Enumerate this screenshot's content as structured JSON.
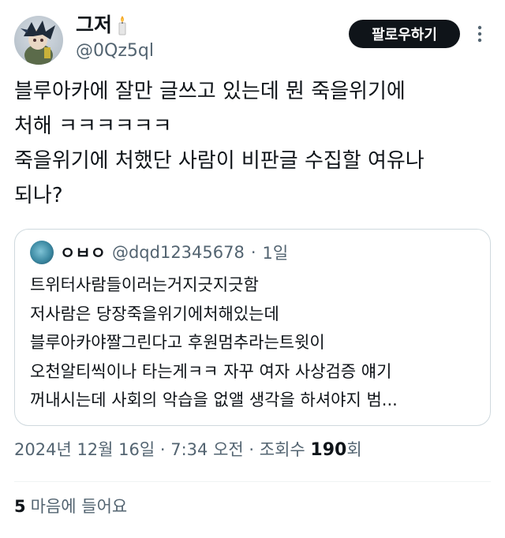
{
  "author": {
    "display_name": "그저",
    "handle": "@0Qz5ql",
    "badge_icon": "candle-icon"
  },
  "follow_label": "팔로우하기",
  "tweet_lines": [
    "블루아카에 잘만 글쓰고 있는데 뭔 죽을위기에",
    "처해 ㅋㅋㅋㅋㅋㅋ",
    "죽을위기에 처했단 사람이 비판글 수집할 여유나",
    "되나?"
  ],
  "quote": {
    "name": "ㅇㅂㅇ",
    "handle": "@dqd12345678",
    "separator": "·",
    "time": "1일",
    "lines": [
      "트위터사람들이러는거지긋지긋함",
      "저사람은 당장죽을위기에처해있는데",
      "블루아카야짤그린다고 후원멈추라는트윗이",
      "오천알티씩이나 타는게ㅋㅋ 자꾸 여자 사상검증 얘기",
      "꺼내시는데 사회의 악습을 없앨 생각을 하셔야지 범..."
    ]
  },
  "meta": {
    "date": "2024년 12월 16일",
    "sep1": " · ",
    "time": "7:34 오전",
    "sep2": " · ",
    "views_label": "조회수 ",
    "views_count": "190",
    "views_suffix": "회"
  },
  "likes": {
    "count": "5",
    "label": "마음에 들어요"
  },
  "colors": {
    "text": "#0f1419",
    "secondary": "#536471",
    "border": "#cfd9de",
    "button_bg": "#0f1419"
  }
}
